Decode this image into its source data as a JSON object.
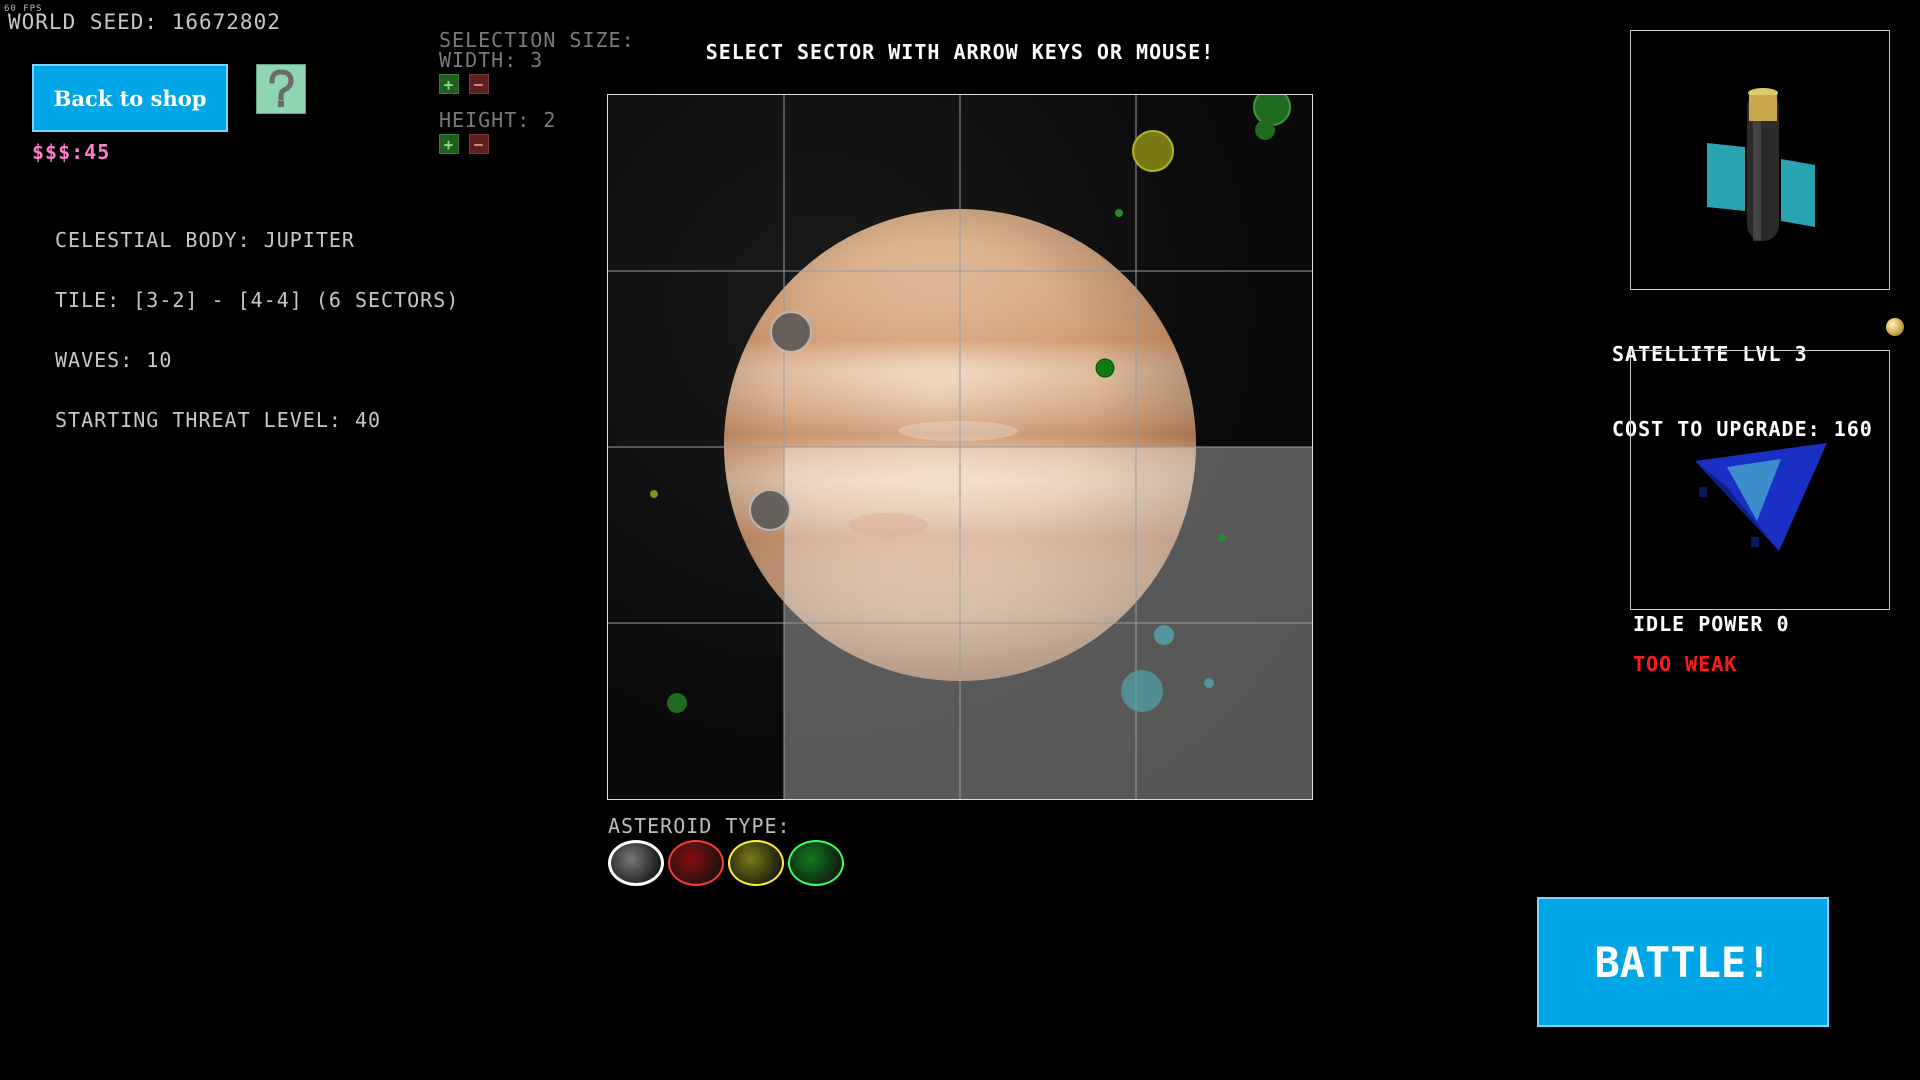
{
  "hud": {
    "fps": "60 FPS",
    "world_seed": "WORLD SEED: 16672802",
    "money": "$$$:45"
  },
  "buttons": {
    "back_to_shop": "Back to shop",
    "battle": "BATTLE!"
  },
  "selection": {
    "title": "SELECTION SIZE:",
    "width_label": "WIDTH: 3",
    "height_label": "HEIGHT: 2",
    "plus": "+",
    "minus": "−"
  },
  "info": {
    "body": "CELESTIAL BODY: JUPITER",
    "tile": "TILE: [3-2] - [4-4] (6 SECTORS)",
    "waves": "WAVES: 10",
    "threat": "STARTING THREAT LEVEL: 40"
  },
  "header": "SELECT SECTOR WITH ARROW KEYS OR MOUSE!",
  "asteroid_type": {
    "label": "ASTEROID TYPE:",
    "types": [
      {
        "name": "grey",
        "color": "#777777"
      },
      {
        "name": "red",
        "color": "#8a0e0e"
      },
      {
        "name": "yellow",
        "color": "#7a7a14"
      },
      {
        "name": "green",
        "color": "#0f7a1f"
      }
    ]
  },
  "satellite": {
    "level": "SATELLITE LVL 3",
    "cost": "COST TO UPGRADE: 160"
  },
  "ship": {
    "idle_power": "IDLE POWER 0",
    "status": "TOO WEAK"
  },
  "grid": {
    "cols": 4,
    "rows": 4,
    "selected": [
      [
        1,
        2
      ],
      [
        2,
        2
      ],
      [
        3,
        2
      ],
      [
        1,
        3
      ],
      [
        2,
        3
      ],
      [
        3,
        3
      ]
    ]
  },
  "colors": {
    "button_blue": "#00a6e6",
    "money_pink": "#ff7fc8",
    "warning_red": "#ff1a1a",
    "help_green": "#8fd6b0"
  }
}
